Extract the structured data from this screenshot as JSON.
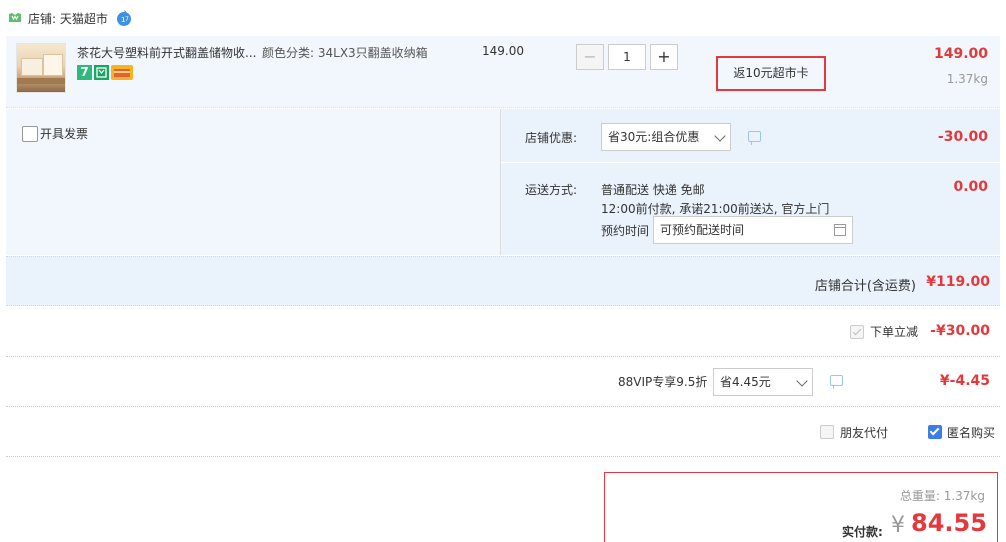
{
  "shop": {
    "label": "店铺: 天猫超市",
    "icon": "shop-icon",
    "chat_icon": "wangwang-icon"
  },
  "item": {
    "title": "茶花大号塑料前开式翻盖储物收...",
    "sku": "颜色分类: 34LX3只翻盖收纳箱",
    "unit_price": "149.00",
    "quantity": "1",
    "minus": "−",
    "plus": "+",
    "rebate": "返10元超市卡",
    "total": "149.00",
    "weight": "1.37kg",
    "badge_seven": "7"
  },
  "invoice": {
    "label": "开具发票"
  },
  "discount": {
    "label": "店铺优惠:",
    "selected": "省30元:组合优惠",
    "amount": "-30.00"
  },
  "shipping": {
    "label": "运送方式:",
    "line1": "普通配送 快递 免邮",
    "line2": "12:00前付款, 承诺21:00前送达, 官方上门",
    "appointment_label": "预约时间",
    "appointment_value": "可预约配送时间",
    "amount": "0.00"
  },
  "subtotal": {
    "label": "店铺合计(含运费)",
    "value": "¥119.00"
  },
  "instant": {
    "label": "下单立减",
    "value": "-¥30.00"
  },
  "vip": {
    "label": "88VIP专享9.5折",
    "selected": "省4.45元",
    "value": "¥-4.45"
  },
  "options": {
    "friend_pay": "朋友代付",
    "anonymous": "匿名购买"
  },
  "payment": {
    "weight": "总重量: 1.37kg",
    "label": "实付款:",
    "currency": "¥",
    "amount": "84.55"
  },
  "colors": {
    "accent_red": "#e4393c",
    "panel_blue": "#f1f7fd",
    "checkbox_blue": "#3b7ee8"
  }
}
